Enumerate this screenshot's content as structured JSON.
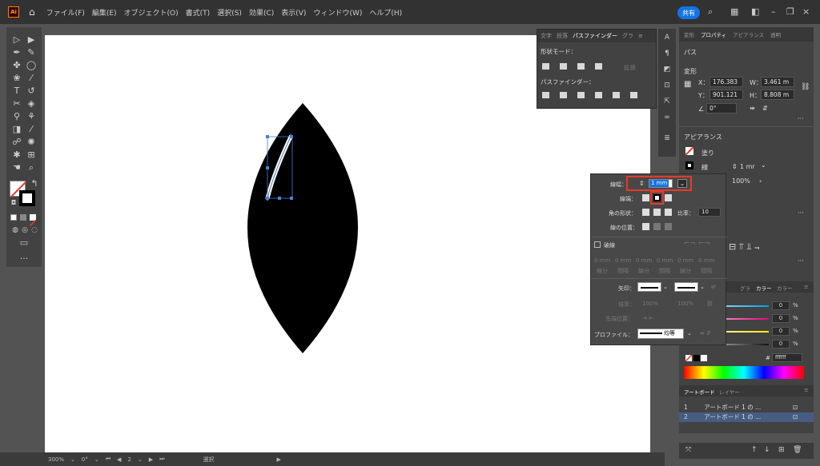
{
  "menubar": {
    "logo": "Ai",
    "menus": [
      "ファイル(F)",
      "編集(E)",
      "オブジェクト(O)",
      "書式(T)",
      "選択(S)",
      "効果(C)",
      "表示(V)",
      "ウィンドウ(W)",
      "ヘルプ(H)"
    ],
    "share_label": "共有"
  },
  "pathfinder": {
    "tabs": [
      "文字",
      "段落",
      "パスファインダー",
      "グラ"
    ],
    "shape_mode_label": "形状モード：",
    "expand_label": "拡張",
    "pathfinder_label": "パスファインダー："
  },
  "properties": {
    "tabs": [
      "変形",
      "プロパティ",
      "アピアランス",
      "透明"
    ],
    "path_label": "パス",
    "transform_label": "変形",
    "x_label": "X：",
    "x_value": "176.383",
    "w_label": "W：",
    "w_value": "3.461 m",
    "y_label": "Y：",
    "y_value": "901.121",
    "h_label": "H：",
    "h_value": "8.808 m",
    "angle_value": "0°",
    "appearance_label": "アピアランス",
    "fill_label": "塗り",
    "stroke_label": "線",
    "stroke_weight_value": "1 mr",
    "opacity_value": "100%"
  },
  "stroke_panel": {
    "weight_label": "線幅：",
    "weight_value": "1 mm",
    "cap_label": "線端：",
    "corner_label": "角の形状：",
    "limit_label": "比率：",
    "limit_value": "10",
    "align_label": "線の位置：",
    "dashed_label": "破線",
    "dash_values": [
      "0 mm",
      "0 mm",
      "0 mm",
      "0 mm",
      "0 mm",
      "0 mm"
    ],
    "dash_sublabels": [
      "線分",
      "間隔",
      "線分",
      "間隔",
      "線分",
      "間隔"
    ],
    "arrow_label": "矢印：",
    "scale_label": "倍率：",
    "scale_value_1": "100%",
    "scale_value_2": "100%",
    "arrow_align_label": "先端位置：",
    "profile_label": "プロファイル：",
    "profile_value": "均等"
  },
  "color_panel": {
    "tabs": [
      "グラ",
      "カラー",
      "カラー"
    ],
    "slider_values": [
      "0",
      "0",
      "0",
      "0"
    ],
    "percent": "%",
    "hex_prefix": "#",
    "hex_value": "ffffff",
    "colors": {
      "cyan": "#00a0e9",
      "magenta": "#e4007f",
      "yellow": "#fff100",
      "black": "#111111"
    }
  },
  "layers": {
    "tabs": [
      "アートボード",
      "レイヤー"
    ],
    "rows": [
      {
        "num": "1",
        "name": "アートボード 1 の ..."
      },
      {
        "num": "2",
        "name": "アートボード 1 の ..."
      }
    ]
  },
  "statusbar": {
    "zoom": "300%",
    "angle": "0°",
    "artboard": "2",
    "mode": "選択"
  },
  "colors": {
    "accent": "#1473e6",
    "highlight": "#e8392a",
    "canvas": "#ffffff",
    "shape": "#000000"
  }
}
